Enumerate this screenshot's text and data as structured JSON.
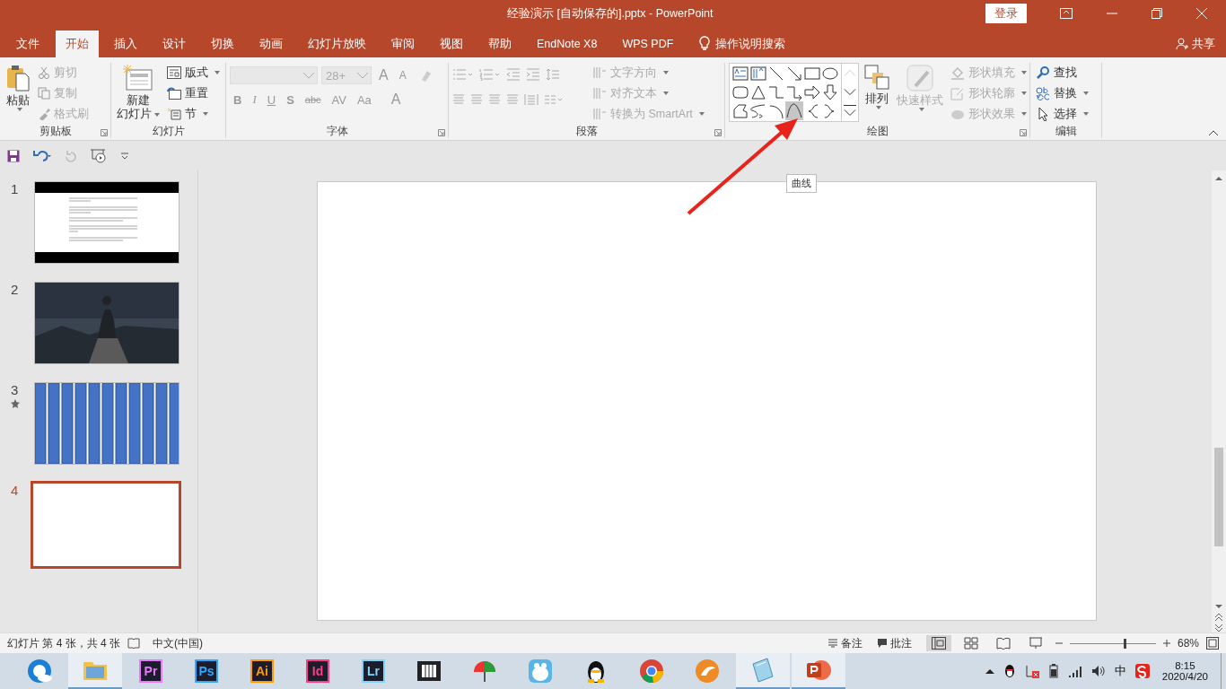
{
  "window": {
    "title": "经验演示 [自动保存的].pptx  -  PowerPoint",
    "login_button": "登录"
  },
  "ribbon_tabs": [
    {
      "label": "文件",
      "selected": false
    },
    {
      "label": "开始",
      "selected": true
    },
    {
      "label": "插入",
      "selected": false
    },
    {
      "label": "设计",
      "selected": false
    },
    {
      "label": "切换",
      "selected": false
    },
    {
      "label": "动画",
      "selected": false
    },
    {
      "label": "幻灯片放映",
      "selected": false
    },
    {
      "label": "审阅",
      "selected": false
    },
    {
      "label": "视图",
      "selected": false
    },
    {
      "label": "帮助",
      "selected": false
    },
    {
      "label": "EndNote X8",
      "selected": false
    },
    {
      "label": "WPS PDF",
      "selected": false
    }
  ],
  "tell_me": "操作说明搜索",
  "share": "共享",
  "clipboard": {
    "paste": "粘贴",
    "items": [
      {
        "label": "剪切",
        "disabled": true
      },
      {
        "label": "复制",
        "disabled": true
      },
      {
        "label": "格式刷",
        "disabled": true
      }
    ],
    "group_label": "剪贴板"
  },
  "slides_group": {
    "new_slide": [
      "新建",
      "幻灯片"
    ],
    "items": [
      "版式",
      "重置",
      "节"
    ],
    "group_label": "幻灯片"
  },
  "font_group": {
    "font_size": "28+",
    "grow": "A",
    "shrink": "A",
    "buttons": [
      "B",
      "I",
      "U",
      "S",
      "abc",
      "AV",
      "Aa",
      "A"
    ],
    "group_label": "字体"
  },
  "paragraph_group": {
    "items": [
      {
        "label": "文字方向",
        "disabled": true
      },
      {
        "label": "对齐文本",
        "disabled": true
      },
      {
        "label": "转换为 SmartArt",
        "disabled": true
      }
    ],
    "group_label": "段落"
  },
  "drawing_group": {
    "shapes": [
      {
        "kind": "textbox",
        "selected": false
      },
      {
        "kind": "vtextbox",
        "selected": false
      },
      {
        "kind": "line",
        "selected": false
      },
      {
        "kind": "arrowline",
        "selected": false
      },
      {
        "kind": "rect",
        "selected": false
      },
      {
        "kind": "oval",
        "selected": false
      },
      {
        "kind": "roundrect",
        "selected": false
      },
      {
        "kind": "triangle",
        "selected": false
      },
      {
        "kind": "elbow",
        "selected": false
      },
      {
        "kind": "elbowarrow",
        "selected": false
      },
      {
        "kind": "rightarrow",
        "selected": false
      },
      {
        "kind": "downarrow",
        "selected": false
      },
      {
        "kind": "freeform",
        "selected": false
      },
      {
        "kind": "scribble",
        "selected": false
      },
      {
        "kind": "arc",
        "selected": false
      },
      {
        "kind": "curve",
        "selected": true
      },
      {
        "kind": "lbrace",
        "selected": false
      },
      {
        "kind": "rbrace",
        "selected": false
      }
    ],
    "arrange": "排列",
    "quick_styles": "快速样式",
    "format_items": [
      {
        "label": "形状填充",
        "disabled": true
      },
      {
        "label": "形状轮廓",
        "disabled": true
      },
      {
        "label": "形状效果",
        "disabled": true
      }
    ],
    "group_label": "绘图"
  },
  "editing_group": {
    "items": [
      "查找",
      "替换",
      "选择"
    ],
    "group_label": "编辑"
  },
  "tooltip": "曲线",
  "slides": [
    {
      "number": "1",
      "kind": "text",
      "selected": false,
      "animated": false
    },
    {
      "number": "2",
      "kind": "picture",
      "selected": false,
      "animated": false
    },
    {
      "number": "3",
      "kind": "stripes",
      "selected": false,
      "animated": true
    },
    {
      "number": "4",
      "kind": "blank",
      "selected": true,
      "animated": false
    }
  ],
  "status_bar": {
    "slide_info": "幻灯片 第 4 张，共 4 张",
    "language": "中文(中国)",
    "notes": "备注",
    "comments": "批注",
    "zoom": "68%"
  },
  "taskbar": {
    "apps": [
      {
        "kind": "browser",
        "running": false
      },
      {
        "kind": "folder",
        "running": true
      },
      {
        "kind": "tile",
        "label": "Pr",
        "color": "#ea77ff",
        "running": false
      },
      {
        "kind": "tile",
        "label": "Ps",
        "color": "#31a8ff",
        "running": false
      },
      {
        "kind": "tile",
        "label": "Ai",
        "color": "#ff9a00",
        "running": false
      },
      {
        "kind": "tile",
        "label": "Id",
        "color": "#ff3d85",
        "running": false
      },
      {
        "kind": "tile",
        "label": "Lr",
        "color": "#7fd4f5",
        "running": false
      },
      {
        "kind": "film",
        "running": false
      },
      {
        "kind": "umbrella",
        "running": false
      },
      {
        "kind": "mascot",
        "running": false
      },
      {
        "kind": "penguin",
        "running": false
      },
      {
        "kind": "chrome",
        "running": false
      },
      {
        "kind": "fox",
        "running": false
      },
      {
        "kind": "notepad",
        "running": true
      },
      {
        "kind": "powerpoint",
        "running": true
      }
    ],
    "ime": "中",
    "time": "8:15",
    "date": "2020/4/20"
  }
}
